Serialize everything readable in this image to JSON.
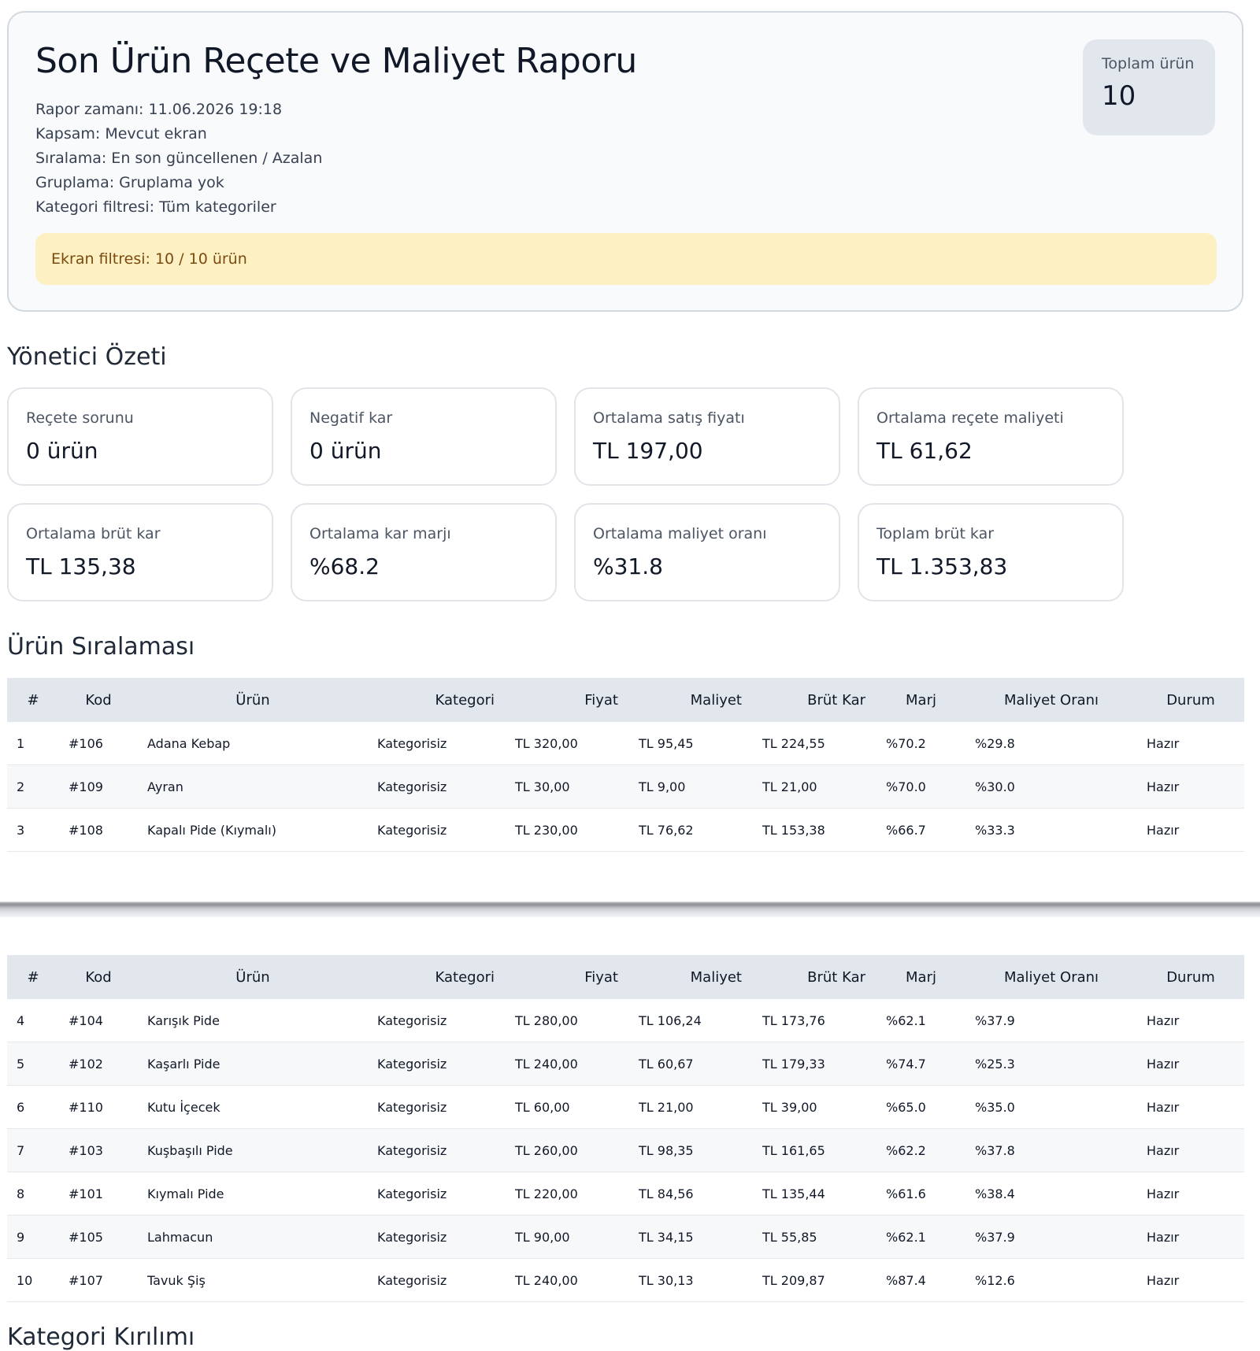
{
  "report": {
    "title": "Son Ürün Reçete ve Maliyet Raporu",
    "meta": {
      "time": "Rapor zamanı: 11.06.2026 19:18",
      "scope": "Kapsam: Mevcut ekran",
      "sort": "Sıralama: En son güncellenen / Azalan",
      "group": "Gruplama: Gruplama yok",
      "category_filter": "Kategori filtresi: Tüm kategoriler"
    },
    "total": {
      "label": "Toplam ürün",
      "value": "10"
    },
    "filter_banner": "Ekran filtresi: 10 / 10 ürün"
  },
  "summary": {
    "title": "Yönetici Özeti",
    "cards": [
      {
        "label": "Reçete sorunu",
        "value": "0 ürün"
      },
      {
        "label": "Negatif kar",
        "value": "0 ürün"
      },
      {
        "label": "Ortalama satış fiyatı",
        "value": "TL 197,00"
      },
      {
        "label": "Ortalama reçete maliyeti",
        "value": "TL 61,62"
      },
      {
        "label": "Ortalama brüt kar",
        "value": "TL 135,38"
      },
      {
        "label": "Ortalama kar marjı",
        "value": "%68.2"
      },
      {
        "label": "Ortalama maliyet oranı",
        "value": "%31.8"
      },
      {
        "label": "Toplam brüt kar",
        "value": "TL 1.353,83"
      }
    ]
  },
  "ranking": {
    "title": "Ürün Sıralaması",
    "columns": [
      "#",
      "Kod",
      "Ürün",
      "Kategori",
      "Fiyat",
      "Maliyet",
      "Brüt Kar",
      "Marj",
      "Maliyet Oranı",
      "Durum"
    ],
    "rows": [
      [
        "1",
        "#106",
        "Adana Kebap",
        "Kategorisiz",
        "TL 320,00",
        "TL 95,45",
        "TL 224,55",
        "%70.2",
        "%29.8",
        "Hazır"
      ],
      [
        "2",
        "#109",
        "Ayran",
        "Kategorisiz",
        "TL 30,00",
        "TL 9,00",
        "TL 21,00",
        "%70.0",
        "%30.0",
        "Hazır"
      ],
      [
        "3",
        "#108",
        "Kapalı Pide (Kıymalı)",
        "Kategorisiz",
        "TL 230,00",
        "TL 76,62",
        "TL 153,38",
        "%66.7",
        "%33.3",
        "Hazır"
      ],
      [
        "4",
        "#104",
        "Karışık Pide",
        "Kategorisiz",
        "TL 280,00",
        "TL 106,24",
        "TL 173,76",
        "%62.1",
        "%37.9",
        "Hazır"
      ],
      [
        "5",
        "#102",
        "Kaşarlı Pide",
        "Kategorisiz",
        "TL 240,00",
        "TL 60,67",
        "TL 179,33",
        "%74.7",
        "%25.3",
        "Hazır"
      ],
      [
        "6",
        "#110",
        "Kutu İçecek",
        "Kategorisiz",
        "TL 60,00",
        "TL 21,00",
        "TL 39,00",
        "%65.0",
        "%35.0",
        "Hazır"
      ],
      [
        "7",
        "#103",
        "Kuşbaşılı Pide",
        "Kategorisiz",
        "TL 260,00",
        "TL 98,35",
        "TL 161,65",
        "%62.2",
        "%37.8",
        "Hazır"
      ],
      [
        "8",
        "#101",
        "Kıymalı Pide",
        "Kategorisiz",
        "TL 220,00",
        "TL 84,56",
        "TL 135,44",
        "%61.6",
        "%38.4",
        "Hazır"
      ],
      [
        "9",
        "#105",
        "Lahmacun",
        "Kategorisiz",
        "TL 90,00",
        "TL 34,15",
        "TL 55,85",
        "%62.1",
        "%37.9",
        "Hazır"
      ],
      [
        "10",
        "#107",
        "Tavuk Şiş",
        "Kategorisiz",
        "TL 240,00",
        "TL 30,13",
        "TL 209,87",
        "%87.4",
        "%12.6",
        "Hazır"
      ]
    ]
  },
  "next_section": {
    "title": "Kategori Kırılımı"
  }
}
